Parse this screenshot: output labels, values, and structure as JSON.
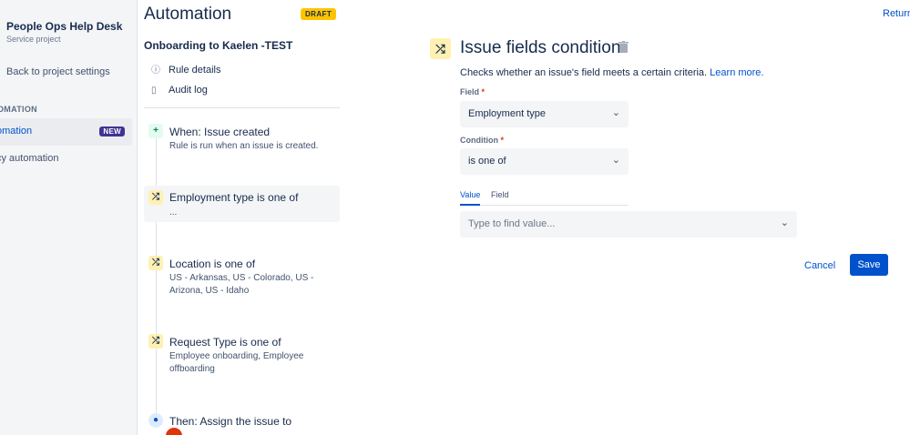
{
  "sidebar": {
    "project_name": "People Ops Help Desk",
    "project_type": "Service project",
    "back_link": "Back to project settings",
    "section_heading": "OMATION",
    "items": [
      {
        "label": "omation",
        "badge": "NEW"
      },
      {
        "label": "cy automation"
      }
    ]
  },
  "rule_panel": {
    "title": "Automation",
    "status_badge": "DRAFT",
    "rule_name": "Onboarding to Kaelen -TEST",
    "links": [
      {
        "label": "Rule details",
        "icon": "info-icon"
      },
      {
        "label": "Audit log",
        "icon": "document-icon"
      }
    ],
    "components": [
      {
        "title": "When: Issue created",
        "description": "Rule is run when an issue is created.",
        "icon": "plus-icon",
        "kind": "trigger"
      },
      {
        "title": "Employment type is one of",
        "description": "...",
        "icon": "branch-icon",
        "kind": "condition",
        "selected": true
      },
      {
        "title": "Location is one of",
        "description": "US - Arkansas, US - Colorado, US - Arizona, US - Idaho",
        "icon": "branch-icon",
        "kind": "condition"
      },
      {
        "title": "Request Type is one of",
        "description": "Employee onboarding, Employee offboarding",
        "icon": "branch-icon",
        "kind": "condition"
      },
      {
        "title": "Then: Assign the issue to",
        "description": "",
        "icon": "person-icon",
        "kind": "action"
      }
    ]
  },
  "editor": {
    "return_link": "Return",
    "title": "Issue fields condition",
    "description": "Checks whether an issue's field meets a certain criteria.",
    "learn_more": "Learn more.",
    "field_label": "Field",
    "field_value": "Employment type",
    "condition_label": "Condition",
    "condition_value": "is one of",
    "required_marker": "*",
    "tabs": [
      {
        "label": "Value",
        "active": true
      },
      {
        "label": "Field",
        "active": false
      }
    ],
    "value_placeholder": "Type to find value...",
    "cancel_label": "Cancel",
    "save_label": "Save"
  },
  "colors": {
    "accent": "#0052cc",
    "draft": "#ffc400",
    "new_badge": "#403294",
    "condition_icon_bg": "#fff0b3"
  }
}
